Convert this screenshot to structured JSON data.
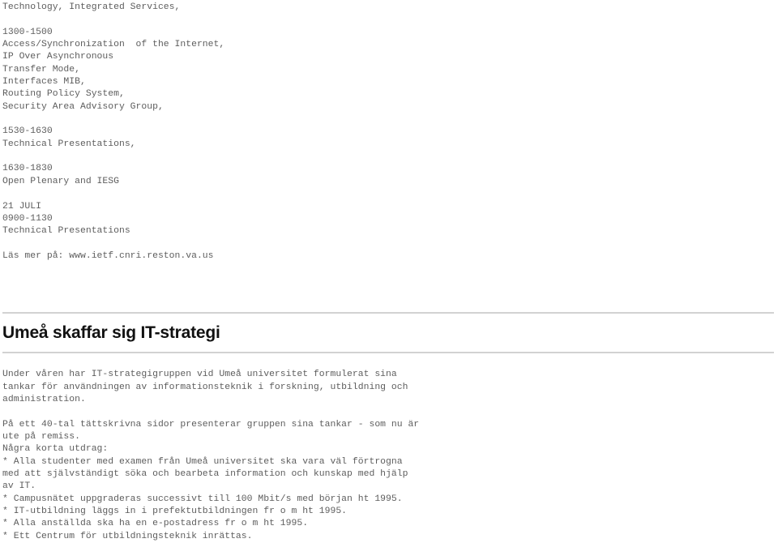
{
  "document": {
    "top_listing": {
      "lines": [
        "Technology, Integrated Services,",
        "",
        "1300-1500",
        "Access/Synchronization  of the Internet,",
        "IP Over Asynchronous",
        "Transfer Mode,",
        "Interfaces MIB,",
        "Routing Policy System,",
        "Security Area Advisory Group,",
        "",
        "1530-1630",
        "Technical Presentations,",
        "",
        "1630-1830",
        "Open Plenary and IESG",
        "",
        "21 JULI",
        "0900-1130",
        "Technical Presentations",
        "",
        "Läs mer på: www.ietf.cnri.reston.va.us"
      ],
      "text": "Technology, Integrated Services,\n\n1300-1500\nAccess/Synchronization  of the Internet,\nIP Over Asynchronous\nTransfer Mode,\nInterfaces MIB,\nRouting Policy System,\nSecurity Area Advisory Group,\n\n1530-1630\nTechnical Presentations,\n\n1630-1830\nOpen Plenary and IESG\n\n21 JULI\n0900-1130\nTechnical Presentations\n\nLäs mer på: www.ietf.cnri.reston.va.us"
    },
    "article": {
      "headline": "Umeå skaffar sig IT-strategi",
      "paragraph_1": "Under våren har IT-strategigruppen vid Umeå universitet formulerat sina\ntankar för användningen av informationsteknik i forskning, utbildning och\nadministration.",
      "paragraph_2": "På ett 40-tal tättskrivna sidor presenterar gruppen sina tankar - som nu är\nute på remiss.\nNågra korta utdrag:",
      "bullets": [
        "* Alla studenter med examen från Umeå universitet ska vara väl förtrogna\nmed att självständigt söka och bearbeta information och kunskap med hjälp\nav IT.",
        "* Campusnätet uppgraderas successivt till 100 Mbit/s med början ht 1995.",
        "* IT-utbildning läggs in i prefektutbildningen fr o m ht 1995.",
        "* Alla anställda ska ha en e-postadress fr o m ht 1995.",
        "* Ett Centrum för utbildningsteknik inrättas."
      ],
      "body_text": "Under våren har IT-strategigruppen vid Umeå universitet formulerat sina\ntankar för användningen av informationsteknik i forskning, utbildning och\nadministration.\n\nPå ett 40-tal tättskrivna sidor presenterar gruppen sina tankar - som nu är\nute på remiss.\nNågra korta utdrag:\n* Alla studenter med examen från Umeå universitet ska vara väl förtrogna\nmed att självständigt söka och bearbeta information och kunskap med hjälp\nav IT.\n* Campusnätet uppgraderas successivt till 100 Mbit/s med början ht 1995.\n* IT-utbildning läggs in i prefektutbildningen fr o m ht 1995.\n* Alla anställda ska ha en e-postadress fr o m ht 1995.\n* Ett Centrum för utbildningsteknik inrättas."
    },
    "style": {
      "text_color": "#5d5d5d",
      "headline_color": "#111111",
      "rule_color": "#d2d2d2",
      "background": "#ffffff"
    }
  }
}
